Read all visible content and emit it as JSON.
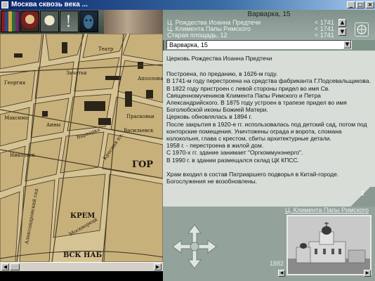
{
  "window": {
    "title": "Москва сквозь века ..."
  },
  "header": {
    "title": "Варварка, 15",
    "list": [
      {
        "name": "Ц. Рождества Иоанна Предтечи",
        "date": "< 1741"
      },
      {
        "name": "Ц. Климента Папы Римского",
        "date": "< 1741"
      },
      {
        "name": "Старая площадь, 12",
        "date": "< 1741"
      },
      {
        "name": "Варварка, 15",
        "date": "< 1741"
      }
    ],
    "combo_value": "Варварка, 15"
  },
  "doc": {
    "title": "Церковь Рождества Иоанна Предтечи",
    "paragraphs": [
      "Построена, по преданию, в 1626-м году.",
      "В 1741-м году перестроена на средства фабриканта Г.Подсевальщикова.",
      "В 1822 году пристроен с левой стороны придел во имя Св. Священномучеников Климента Папы Римского и Петра Александрийского. В 1875 году устроен в трапезе придел во имя Боголюбской иконы Божией Матери.",
      "Церковь обновлялась в 1894 г.",
      "После закрытия в 1920-е гг. использовалась под детский сад, потом под конторские помещения. Уничтожены ограда и ворота, сломана колокольня, глава с крестом, сбиты архитектурные детали.",
      "1958 г. - перестроена в жилой дом.",
      "С 1970-х гг. здание занимает \"Оргкоммунэнерго\".",
      "В 1990 г. в здании размещался склад ЦК КПСС."
    ],
    "closing": "Храм входил в состав Патриаршего подворья в Китай-городе. Богослужения не возобновлены.",
    "page_number": "2"
  },
  "photo": {
    "title": "Ц. Климента Папы Римского",
    "year": "1882"
  },
  "map": {
    "labels": [
      "Театр",
      "Георгия",
      "Максима",
      "Прасковьи",
      "Зачатья",
      "Аполлона",
      "Анны",
      "Варварка",
      "Васильевск",
      "Красная пл.",
      "Никольск",
      "ГОР",
      "КРЕМ",
      "Москворецк",
      "Александровский сад",
      "ВСК НАБ"
    ]
  },
  "colors": {
    "accent": "#0a246a",
    "panel": "#d8ddd8",
    "stone": "#93a39b"
  }
}
